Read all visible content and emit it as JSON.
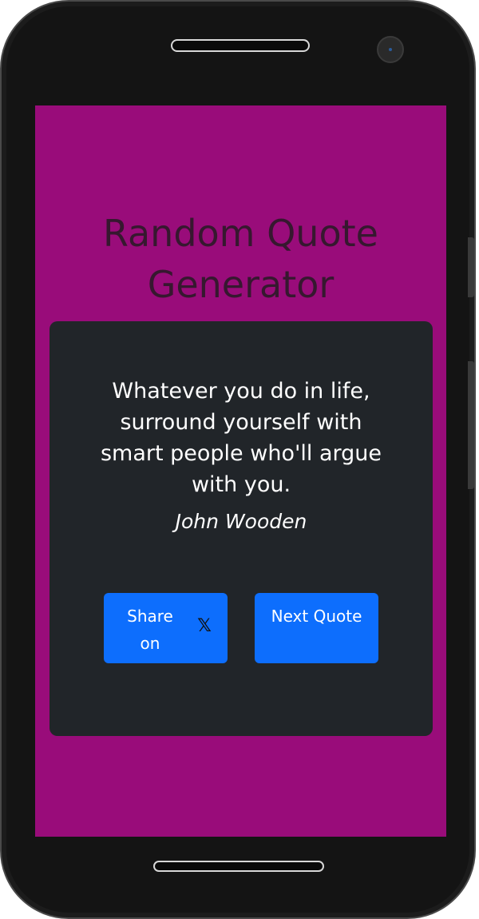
{
  "app": {
    "title": "Random Quote Generator"
  },
  "quote": {
    "text": "Whatever you do in life, surround yourself with smart people who'll argue with you.",
    "author": "John Wooden"
  },
  "buttons": {
    "share_label": "Share on",
    "share_icon": "x-logo-icon",
    "next_label": "Next Quote"
  },
  "colors": {
    "screen_background": "#990c7a",
    "card_background": "#212529",
    "button_primary": "#0d6efd",
    "title_text": "#36182f"
  }
}
